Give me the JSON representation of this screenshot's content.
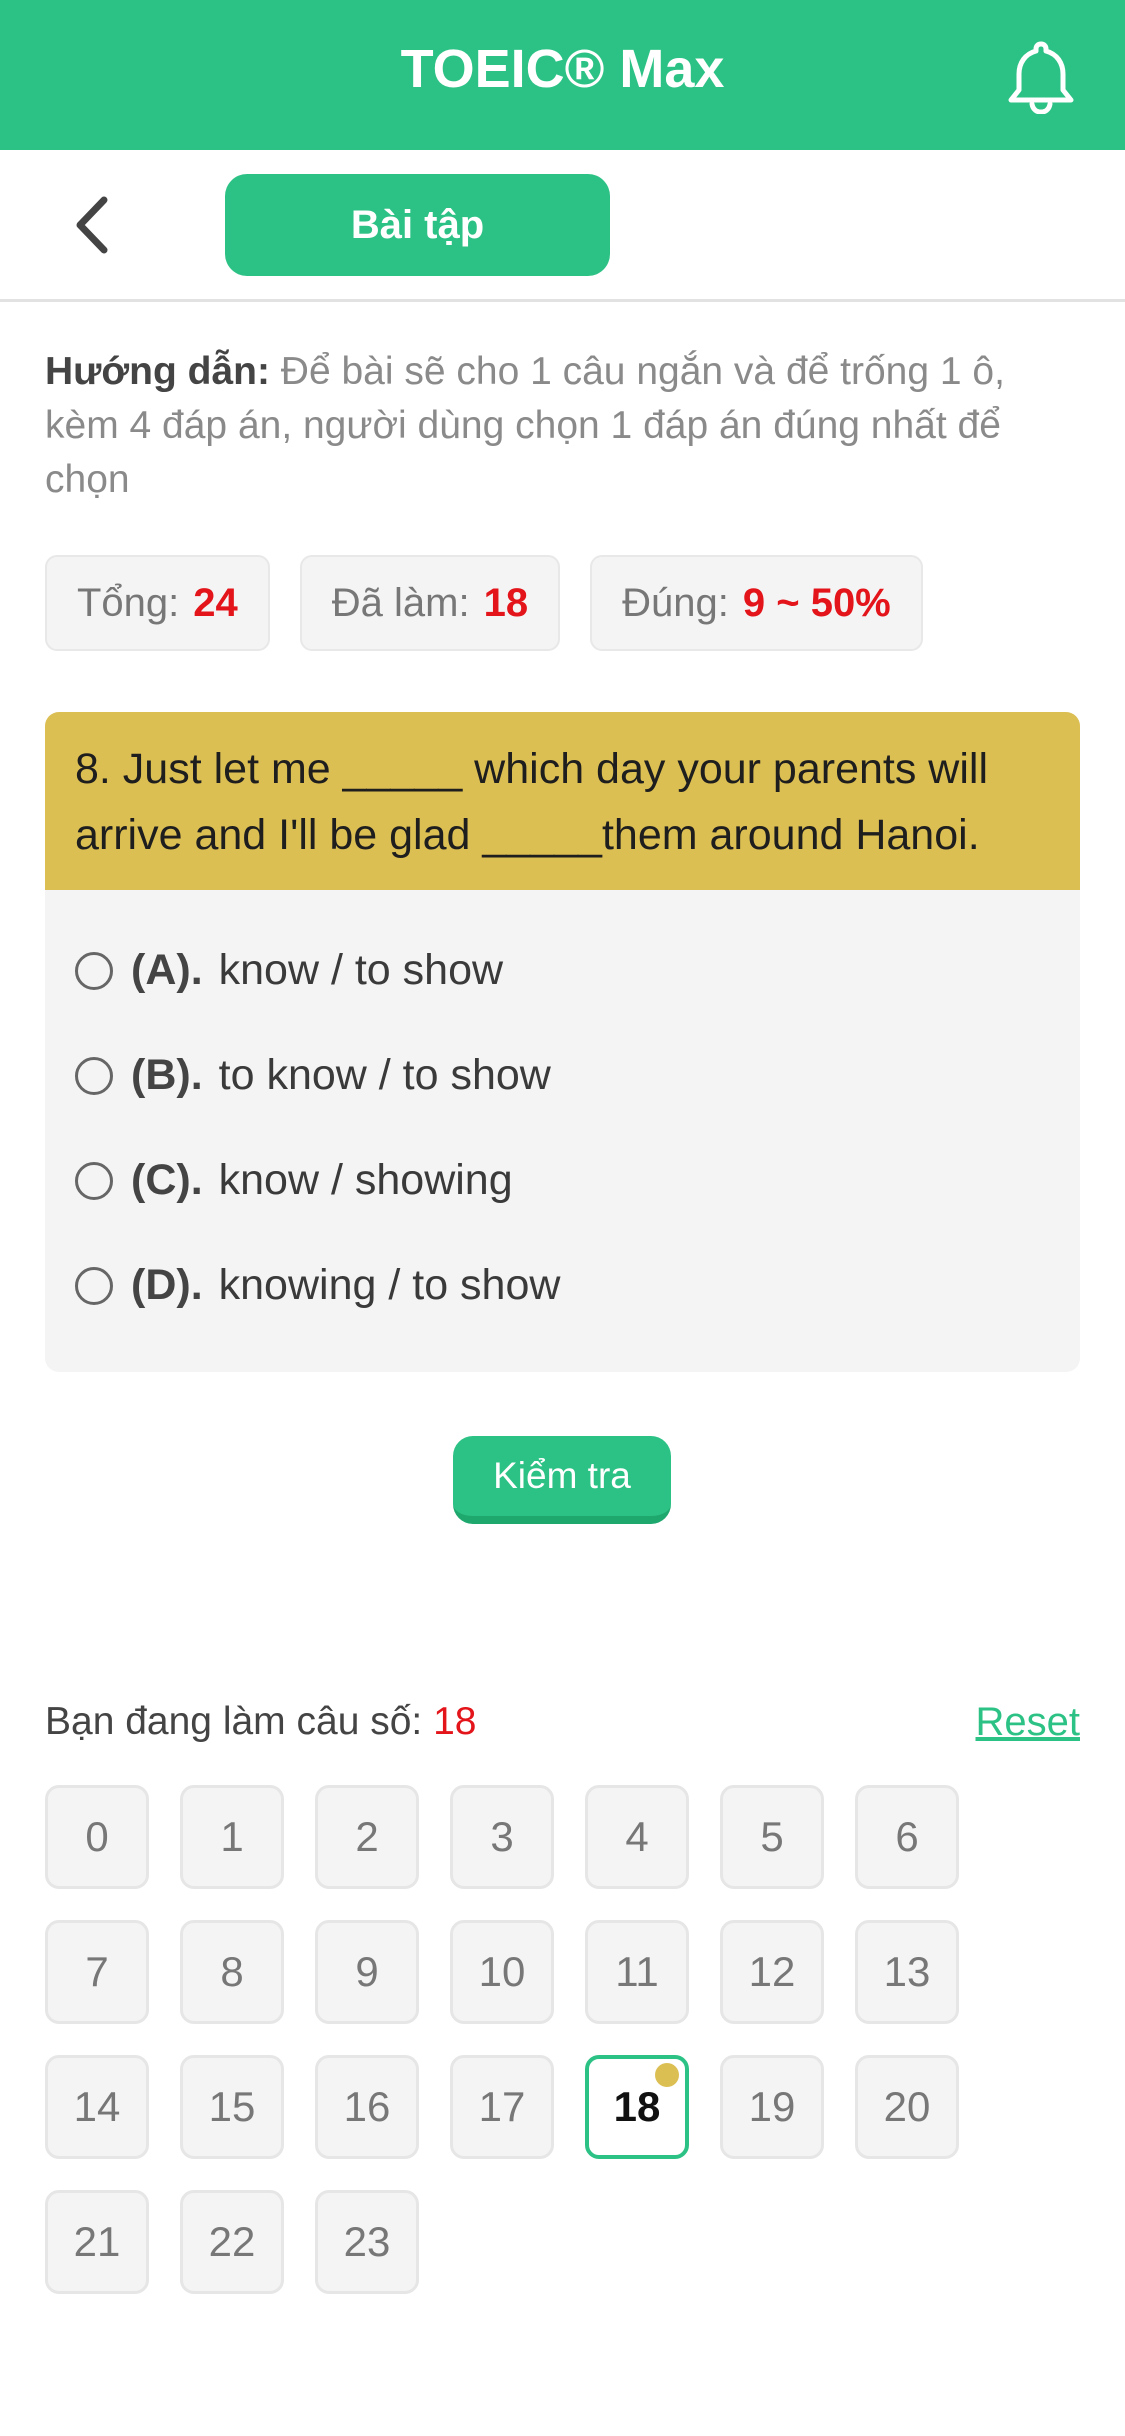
{
  "header": {
    "title": "TOEIC® Max",
    "bell_icon": "bell-icon"
  },
  "subbar": {
    "back_icon": "chevron-left-icon",
    "tab_label": "Bài tập"
  },
  "instructions": {
    "label": "Hướng dẫn:",
    "text": "Để bài sẽ cho 1 câu ngắn và để trống 1 ô, kèm 4 đáp án, người dùng chọn 1 đáp án đúng nhất để chọn"
  },
  "stats": {
    "total_label": "Tổng:",
    "total_value": "24",
    "done_label": "Đã làm:",
    "done_value": "18",
    "correct_label": "Đúng:",
    "correct_value": "9 ~ 50%"
  },
  "question": {
    "text": "8. Just let me _____ which day your parents will arrive and I'll be glad _____them around Hanoi.",
    "options": [
      {
        "label": "(A).",
        "text": "know / to show"
      },
      {
        "label": "(B).",
        "text": "to know / to show"
      },
      {
        "label": "(C).",
        "text": "know / showing"
      },
      {
        "label": "(D).",
        "text": "knowing / to show"
      }
    ]
  },
  "check_button": "Kiểm tra",
  "progress": {
    "label": "Bạn đang làm câu số:",
    "current": "18",
    "reset_label": "Reset",
    "numbers": [
      "0",
      "1",
      "2",
      "3",
      "4",
      "5",
      "6",
      "7",
      "8",
      "9",
      "10",
      "11",
      "12",
      "13",
      "14",
      "15",
      "16",
      "17",
      "18",
      "19",
      "20",
      "21",
      "22",
      "23"
    ],
    "active_index": 18
  },
  "colors": {
    "brand": "#2dc285",
    "question_header": "#dcbf53",
    "highlight": "#e3141a"
  }
}
